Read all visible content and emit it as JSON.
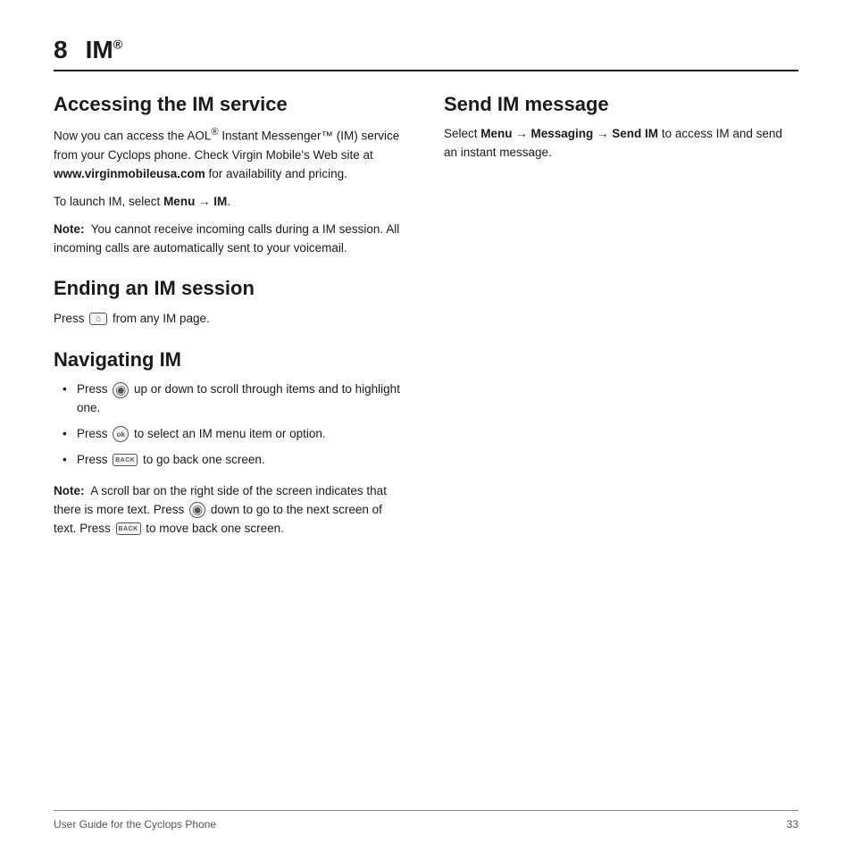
{
  "header": {
    "chapter": "8",
    "title": "IM",
    "title_sup": "®"
  },
  "left_column": {
    "section1": {
      "title": "Accessing the IM service",
      "paragraphs": [
        "Now you can access the AOL® Instant Messenger™ (IM) service from your Cyclops phone. Check Virgin Mobile's Web site at www.virginmobileusa.com for availability and pricing.",
        "To launch IM, select Menu → IM."
      ],
      "note": "Note:  You cannot receive incoming calls during a IM session. All incoming calls are automatically sent to your voicemail."
    },
    "section2": {
      "title": "Ending an IM session",
      "text": "Press [end] from any IM page."
    },
    "section3": {
      "title": "Navigating IM",
      "bullets": [
        "Press [nav] up or down to scroll through items and to highlight one.",
        "Press [ok] to select an IM menu item or option.",
        "Press [back] to go back one screen."
      ],
      "note": "Note:  A scroll bar on the right side of the screen indicates that there is more text. Press [nav] down to go to the next screen of text. Press [back] to move back one screen."
    }
  },
  "right_column": {
    "section1": {
      "title": "Send IM message",
      "text": "Select Menu → Messaging → Send IM to access IM and send an instant message."
    }
  },
  "footer": {
    "left": "User Guide for the Cyclops Phone",
    "right": "33"
  }
}
